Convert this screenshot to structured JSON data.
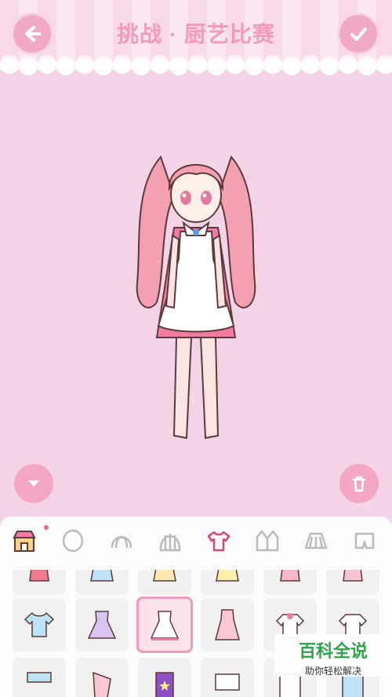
{
  "header": {
    "title": "挑战 · 厨艺比赛",
    "back_icon": "arrow-left-icon",
    "confirm_icon": "checkmark-icon"
  },
  "stage": {
    "down_icon": "chevron-down-icon",
    "trash_icon": "trash-icon"
  },
  "tabs": [
    {
      "icon": "shop-icon",
      "active": false
    },
    {
      "icon": "head-icon",
      "active": false
    },
    {
      "icon": "hair-front-icon",
      "active": false
    },
    {
      "icon": "hair-back-icon",
      "active": false
    },
    {
      "icon": "shirt-icon",
      "active": true
    },
    {
      "icon": "jacket-icon",
      "active": false
    },
    {
      "icon": "skirt-icon",
      "active": false
    },
    {
      "icon": "pants-icon",
      "active": false
    }
  ],
  "watermark": {
    "title": "百科全说",
    "subtitle": "助你轻松解决"
  },
  "colors": {
    "background": "#f5d3e6",
    "accent": "#f2a9c6",
    "title": "#f19ac0"
  }
}
